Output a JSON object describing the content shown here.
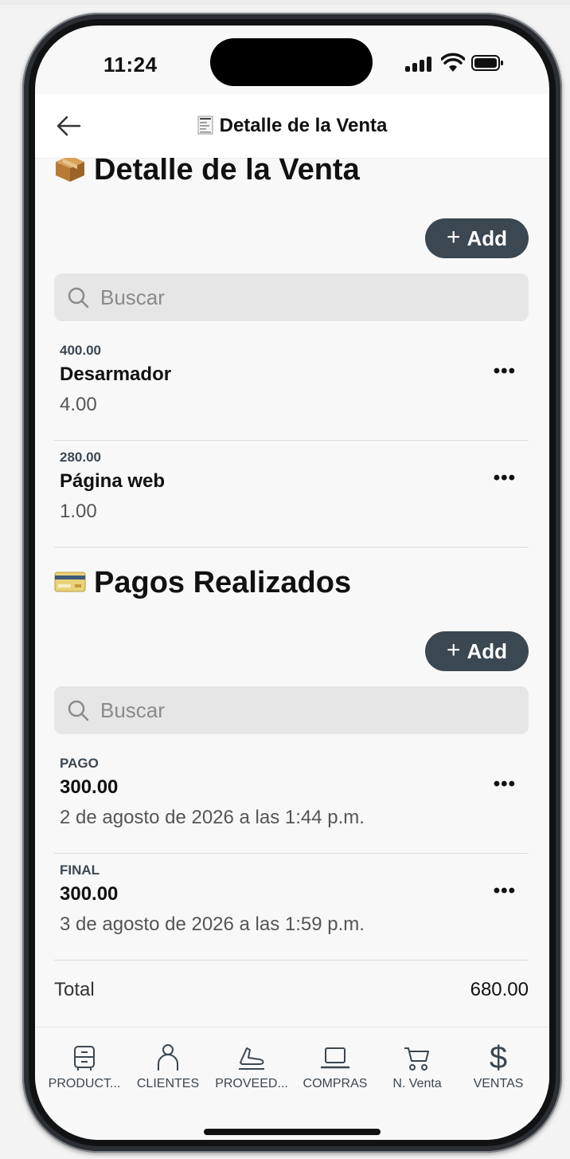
{
  "status_bar": {
    "time": "11:24"
  },
  "nav": {
    "title": "Detalle de la Venta"
  },
  "items_section": {
    "title": "Detalle de la Venta",
    "add_label": "Add",
    "search_placeholder": "Buscar",
    "rows": [
      {
        "tag": "400.00",
        "name": "Desarmador",
        "qty": "4.00"
      },
      {
        "tag": "280.00",
        "name": "Página web",
        "qty": "1.00"
      }
    ]
  },
  "payments_section": {
    "title": "Pagos Realizados",
    "add_label": "Add",
    "search_placeholder": "Buscar",
    "rows": [
      {
        "tag": "PAGO",
        "amount": "300.00",
        "date": "2 de agosto de 2026 a las 1:44 p.m."
      },
      {
        "tag": "FINAL",
        "amount": "300.00",
        "date": "3 de agosto de 2026 a las 1:59 p.m."
      }
    ]
  },
  "total": {
    "label": "Total",
    "value": "680.00"
  },
  "tabs": [
    {
      "label": "PRODUCT...",
      "icon": "archive-icon"
    },
    {
      "label": "CLIENTES",
      "icon": "person-icon"
    },
    {
      "label": "PROVEED...",
      "icon": "plane-icon"
    },
    {
      "label": "COMPRAS",
      "icon": "laptop-icon"
    },
    {
      "label": "N. Venta",
      "icon": "cart-icon"
    },
    {
      "label": "VENTAS",
      "icon": "dollar-icon"
    }
  ],
  "colors": {
    "accent": "#3b4751",
    "background": "#f8f8f8",
    "search_bg": "#e6e6e6"
  }
}
